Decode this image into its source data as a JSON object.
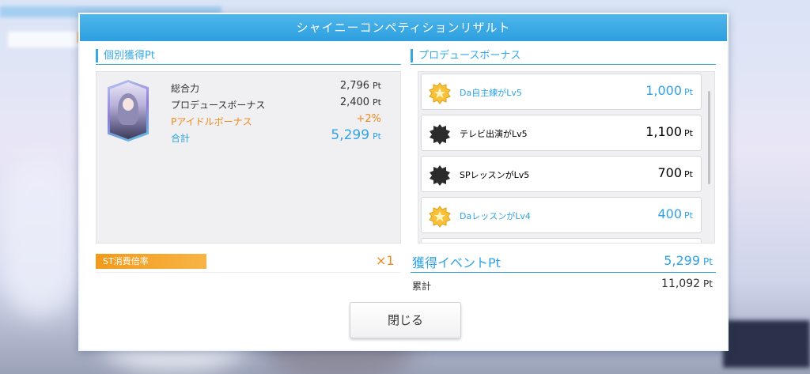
{
  "modal": {
    "title": "シャイニーコンペティションリザルト"
  },
  "individual": {
    "section_title": "個別獲得Pt",
    "rows": [
      {
        "label": "総合力",
        "value": "2,796",
        "unit": "Pt"
      },
      {
        "label": "プロデュースボーナス",
        "value": "2,400",
        "unit": "Pt"
      },
      {
        "label": "Pアイドルボーナス",
        "value": "+2%",
        "unit": ""
      },
      {
        "label": "合計",
        "value": "5,299",
        "unit": "Pt"
      }
    ]
  },
  "produce_bonus": {
    "section_title": "プロデュースボーナス",
    "items": [
      {
        "name": "Da自主練がLv5",
        "value": "1,000",
        "unit": "Pt",
        "icon": "gold-star-badge-icon",
        "active": true
      },
      {
        "name": "テレビ出演がLv5",
        "value": "1,100",
        "unit": "Pt",
        "icon": "dark-star-badge-icon",
        "active": false
      },
      {
        "name": "SPレッスンがLv5",
        "value": "700",
        "unit": "Pt",
        "icon": "dark-star-badge-icon",
        "active": false
      },
      {
        "name": "DaレッスンがLv4",
        "value": "400",
        "unit": "Pt",
        "icon": "gold-star-badge-icon",
        "active": true
      }
    ]
  },
  "st": {
    "label": "ST消費倍率",
    "multiplier": "×1"
  },
  "event": {
    "label": "獲得イベントPt",
    "value": "5,299",
    "unit": "Pt"
  },
  "cumulative": {
    "label": "累計",
    "value": "11,092",
    "unit": "Pt"
  },
  "close_button": {
    "label": "閉じる"
  },
  "colors": {
    "accent": "#2fa3e3",
    "orange": "#f08a1c",
    "header": "#36a8e6"
  }
}
